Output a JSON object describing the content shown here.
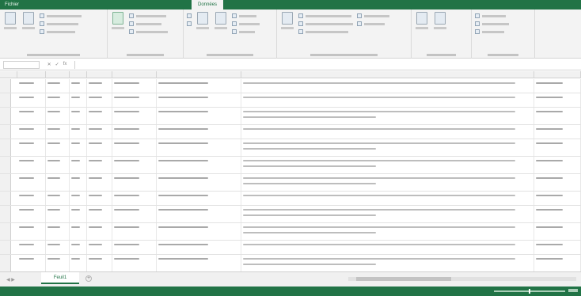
{
  "ribbon_tabs": [
    {
      "label": "Fichier"
    },
    {
      "label": ""
    },
    {
      "label": ""
    },
    {
      "label": ""
    },
    {
      "label": ""
    },
    {
      "label": ""
    },
    {
      "label": "Données",
      "active": true
    },
    {
      "label": ""
    },
    {
      "label": ""
    },
    {
      "label": ""
    }
  ],
  "account_label": "",
  "formula_bar": {
    "name_box": "",
    "formula": ""
  },
  "sheet_tab": "Feuil1",
  "colors": {
    "accent": "#217346"
  },
  "icons": [
    "get-data-icon",
    "refresh-icon",
    "sort-icon",
    "filter-icon",
    "text-to-columns-icon",
    "what-if-icon",
    "forecast-icon",
    "group-icon"
  ],
  "rows": [
    {
      "tall": false
    },
    {
      "tall": false
    },
    {
      "tall": true
    },
    {
      "tall": false
    },
    {
      "tall": true
    },
    {
      "tall": true
    },
    {
      "tall": true
    },
    {
      "tall": false
    },
    {
      "tall": true
    },
    {
      "tall": true
    },
    {
      "tall": false
    },
    {
      "tall": true
    }
  ]
}
